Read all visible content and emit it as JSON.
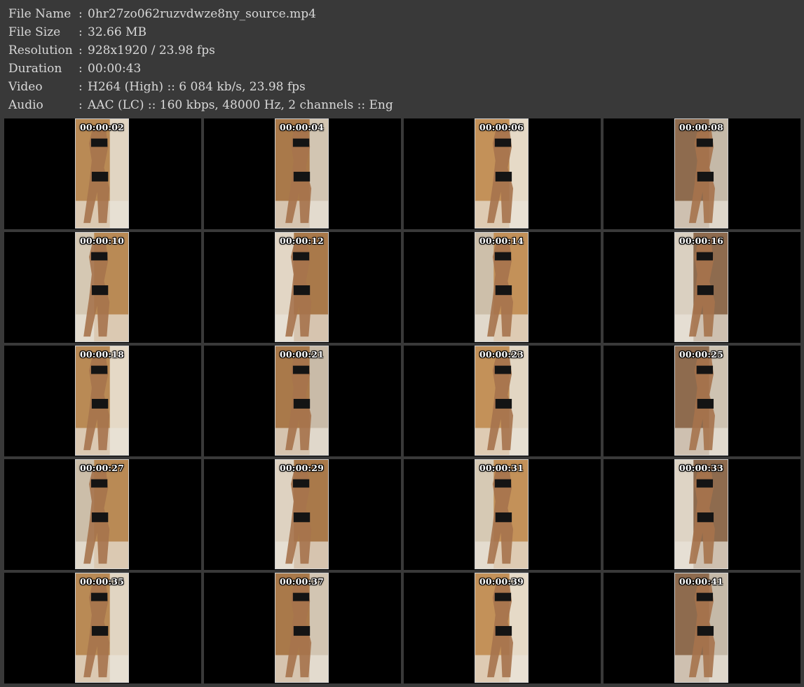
{
  "info": [
    {
      "label": "File Name",
      "sep": ":",
      "value": "0hr27zo062ruzvdwze8ny_source.mp4"
    },
    {
      "label": "File Size",
      "sep": ":",
      "value": "32.66 MB"
    },
    {
      "label": "Resolution",
      "sep": ":",
      "value": "928x1920 / 23.98 fps"
    },
    {
      "label": "Duration",
      "sep": ":",
      "value": "00:00:43"
    },
    {
      "label": "Video",
      "sep": ":",
      "value": "H264 (High) :: 6 084 kb/s, 23.98 fps"
    },
    {
      "label": "Audio",
      "sep": ":",
      "value": "AAC (LC) :: 160 kbps, 48000 Hz, 2 channels :: Eng"
    }
  ],
  "thumbnails": [
    {
      "timestamp": "00:00:02"
    },
    {
      "timestamp": "00:00:04"
    },
    {
      "timestamp": "00:00:06"
    },
    {
      "timestamp": "00:00:08"
    },
    {
      "timestamp": "00:00:10"
    },
    {
      "timestamp": "00:00:12"
    },
    {
      "timestamp": "00:00:14"
    },
    {
      "timestamp": "00:00:16"
    },
    {
      "timestamp": "00:00:18"
    },
    {
      "timestamp": "00:00:21"
    },
    {
      "timestamp": "00:00:23"
    },
    {
      "timestamp": "00:00:25"
    },
    {
      "timestamp": "00:00:27"
    },
    {
      "timestamp": "00:00:29"
    },
    {
      "timestamp": "00:00:31"
    },
    {
      "timestamp": "00:00:33"
    },
    {
      "timestamp": "00:00:35"
    },
    {
      "timestamp": "00:00:37"
    },
    {
      "timestamp": "00:00:39"
    },
    {
      "timestamp": "00:00:41"
    }
  ],
  "colors": {
    "background": "#393939",
    "text": "#d8d8d8",
    "cell": "#000000",
    "frame_border": "#cfcfcf"
  }
}
